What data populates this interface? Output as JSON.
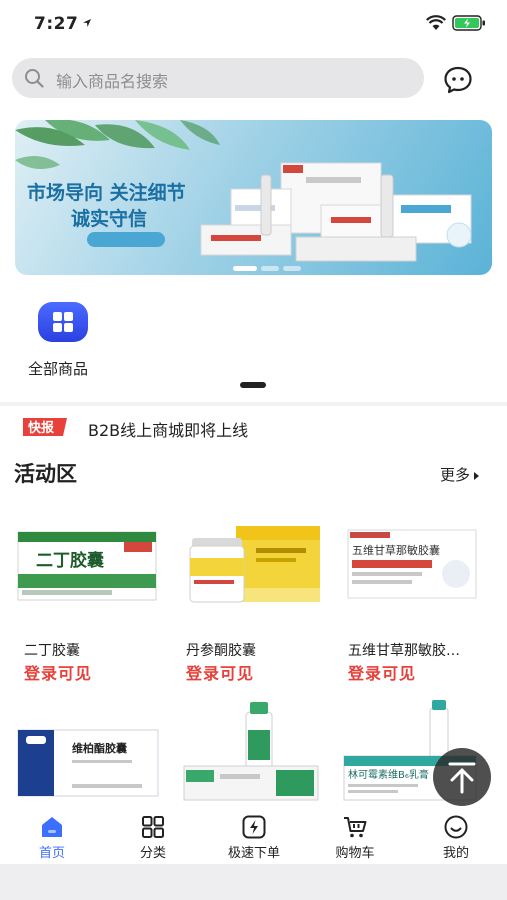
{
  "status_bar": {
    "time": "7:27"
  },
  "search": {
    "placeholder": "输入商品名搜索",
    "icon": "search-icon",
    "message_icon": "chat-bubble-icon"
  },
  "banner": {
    "title": "市场导向 关注细节",
    "subtitle": "诚实守信",
    "active_dot": 0
  },
  "categories": [
    {
      "label": "全部商品",
      "icon": "grid-squares-icon"
    }
  ],
  "news": {
    "badge": "快报",
    "text": "B2B线上商城即将上线"
  },
  "activity": {
    "title": "活动区",
    "more": "更多",
    "products": [
      {
        "name": "二丁胶囊",
        "price": "登录可见",
        "box_label": "二丁胶囊"
      },
      {
        "name": "丹参酮胶囊",
        "price": "登录可见"
      },
      {
        "name": "五维甘草那敏胶…",
        "price": "登录可见",
        "box_label": "五维甘草那敏胶囊"
      },
      {
        "name": "",
        "price": "",
        "box_label": "维柏酯胶囊"
      },
      {
        "name": "",
        "price": ""
      },
      {
        "name": "",
        "price": "",
        "box_label": "林可霉素维B₆乳膏"
      }
    ]
  },
  "tabs": [
    {
      "label": "首页",
      "icon": "home-icon",
      "active": true
    },
    {
      "label": "分类",
      "icon": "category-grid-icon",
      "active": false
    },
    {
      "label": "极速下单",
      "icon": "lightning-icon",
      "active": false
    },
    {
      "label": "购物车",
      "icon": "cart-icon",
      "active": false
    },
    {
      "label": "我的",
      "icon": "smile-face-icon",
      "active": false
    }
  ],
  "colors": {
    "accent": "#3d6fff",
    "price": "#e8413c",
    "badge": "#e8413c"
  }
}
